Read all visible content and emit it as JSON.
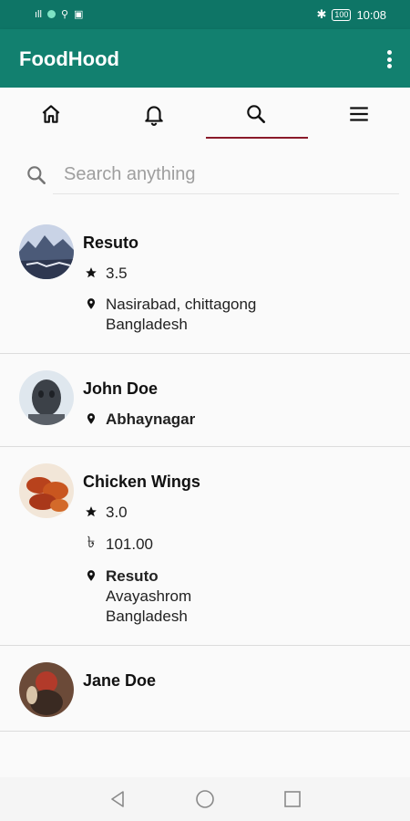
{
  "status_bar": {
    "left_text": "ıll",
    "time": "10:08",
    "battery": "100"
  },
  "app": {
    "title": "FoodHood"
  },
  "tabs": [
    {
      "icon": "home-icon"
    },
    {
      "icon": "bell-icon"
    },
    {
      "icon": "search-icon",
      "selected": true
    },
    {
      "icon": "menu-icon"
    }
  ],
  "search": {
    "placeholder": "Search anything",
    "value": ""
  },
  "results": [
    {
      "title": "Resuto",
      "rating": "3.5",
      "address_line1": "Nasirabad, chittagong",
      "address_line2": "Bangladesh"
    },
    {
      "title": "John Doe",
      "location": "Abhaynagar"
    },
    {
      "title": "Chicken Wings",
      "rating": "3.0",
      "price": "101.00",
      "restaurant": "Resuto",
      "address_line1": "Avayashrom",
      "address_line2": "Bangladesh"
    },
    {
      "title": "Jane Doe"
    }
  ],
  "colors": {
    "status_bar": "#0e7566",
    "app_bar": "#12806f",
    "tab_indicator": "#8a1a2a"
  }
}
